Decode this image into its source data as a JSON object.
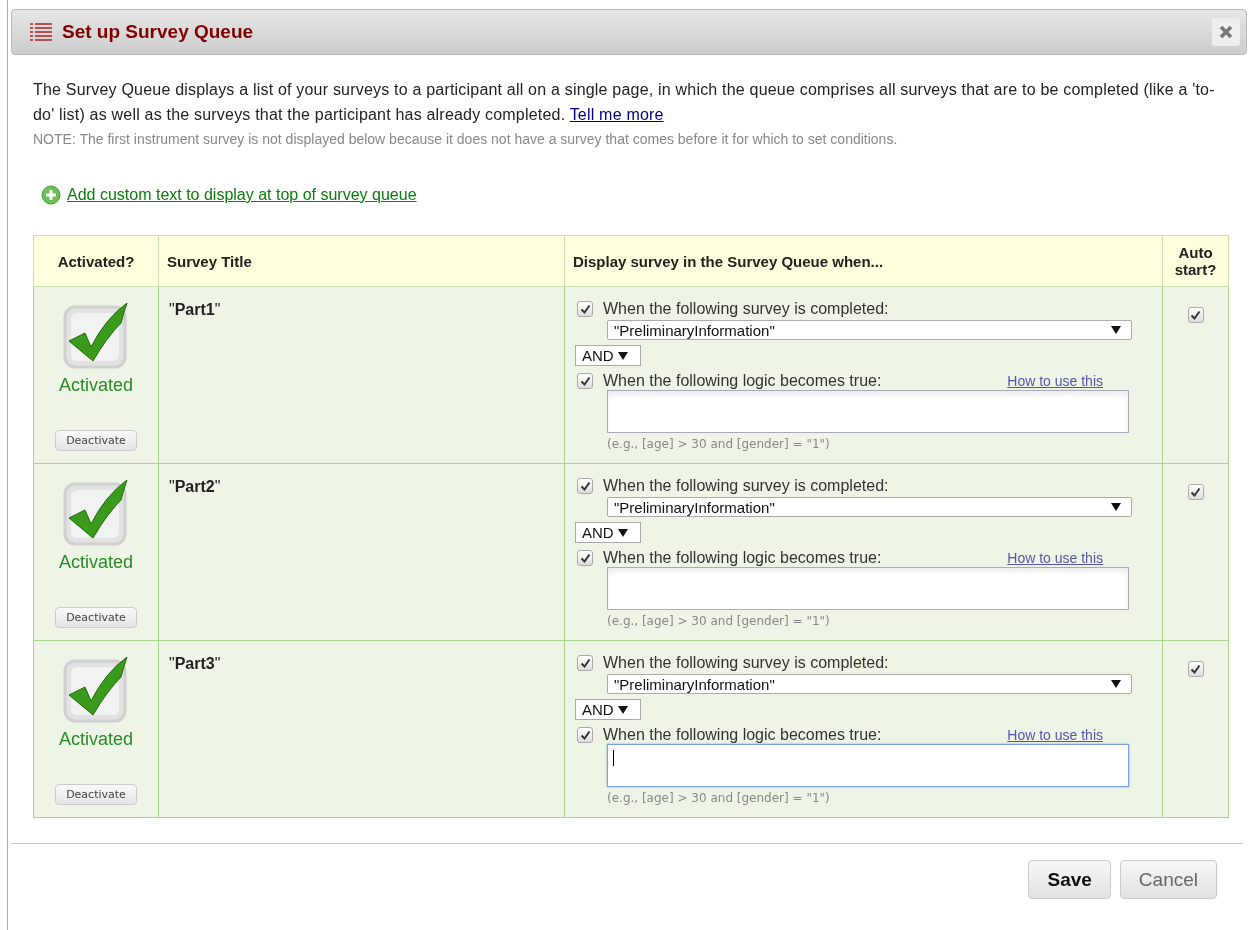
{
  "dialog": {
    "title": "Set up Survey Queue"
  },
  "intro": {
    "text": "The Survey Queue displays a list of your surveys to a participant all on a single page, in which the queue comprises all surveys that are to be completed (like a 'to-do' list) as well as the surveys that the participant has already completed.",
    "link": "Tell me more"
  },
  "note": "NOTE: The first instrument survey is not displayed below because it does not have a survey that comes before it for which to set conditions.",
  "add_link": "Add custom text to display at top of survey queue",
  "table": {
    "columns": [
      "Activated?",
      "Survey Title",
      "Display survey in the Survey Queue when...",
      "Auto start?"
    ],
    "rows": [
      {
        "activated": true,
        "status": "Activated",
        "button": "Deactivate",
        "title": "\"**Part1**\"",
        "survey_condition": {
          "checked": true,
          "label": "When the following survey is completed:",
          "value": "\"PreliminaryInformation\""
        },
        "operator": "AND",
        "logic_condition": {
          "checked": true,
          "label": "When the following logic becomes true:",
          "help_link": "How to use this",
          "focused": false,
          "example": "(e.g., [age] > 30 and [gender] = \"1\")"
        },
        "auto_start": true
      },
      {
        "activated": true,
        "status": "Activated",
        "button": "Deactivate",
        "title": "\"**Part2**\"",
        "survey_condition": {
          "checked": true,
          "label": "When the following survey is completed:",
          "value": "\"PreliminaryInformation\""
        },
        "operator": "AND",
        "logic_condition": {
          "checked": true,
          "label": "When the following logic becomes true:",
          "help_link": "How to use this",
          "focused": false,
          "example": "(e.g., [age] > 30 and [gender] = \"1\")"
        },
        "auto_start": true
      },
      {
        "activated": true,
        "status": "Activated",
        "button": "Deactivate",
        "title": "\"**Part3**\"",
        "survey_condition": {
          "checked": true,
          "label": "When the following survey is completed:",
          "value": "\"PreliminaryInformation\""
        },
        "operator": "AND",
        "logic_condition": {
          "checked": true,
          "label": "When the following logic becomes true:",
          "help_link": "How to use this",
          "focused": true,
          "example": "(e.g., [age] > 30 and [gender] = \"1\")"
        },
        "auto_start": true
      }
    ]
  },
  "buttons": [
    {
      "label": "Save",
      "kind": "primary"
    },
    {
      "label": "Cancel",
      "kind": "secondary"
    }
  ]
}
